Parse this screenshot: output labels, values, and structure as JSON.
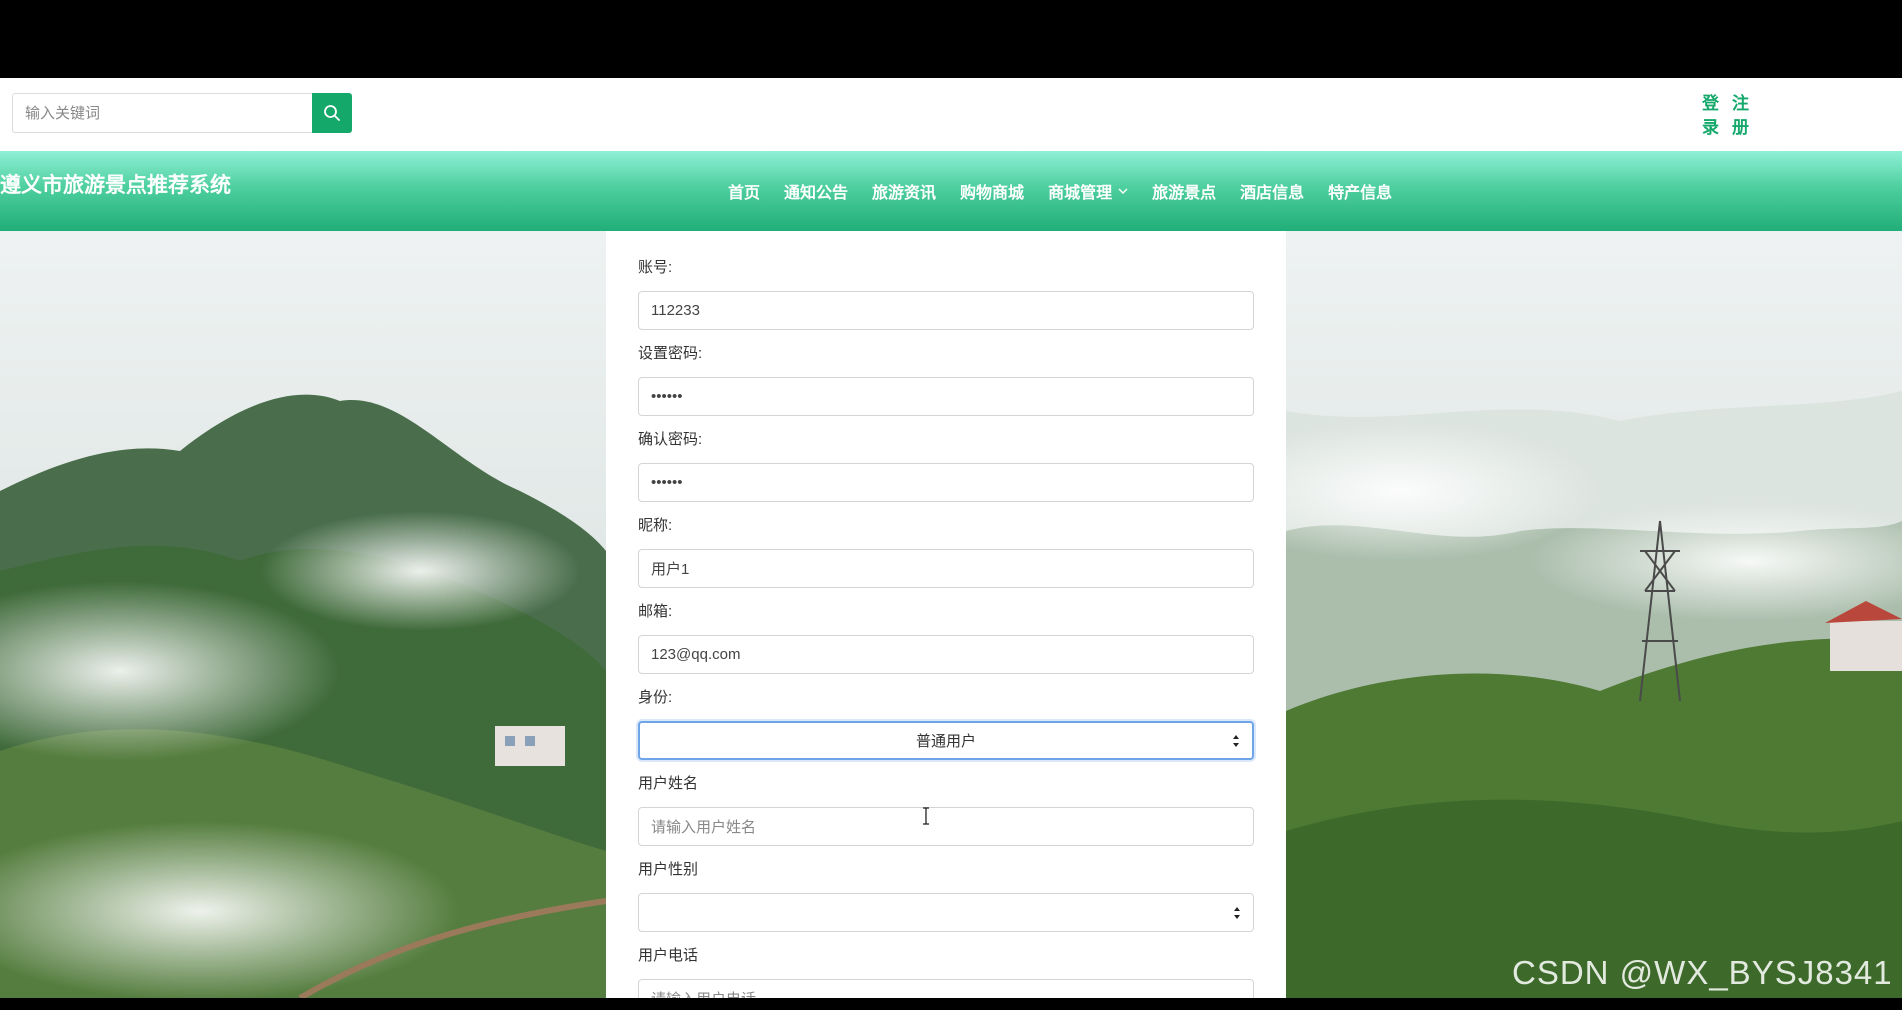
{
  "search": {
    "placeholder": "输入关键词"
  },
  "auth": {
    "login": "登录",
    "register": "注册"
  },
  "site_title": "遵义市旅游景点推荐系统",
  "nav": {
    "items": [
      "首页",
      "通知公告",
      "旅游资讯",
      "购物商城",
      "商城管理",
      "旅游景点",
      "酒店信息",
      "特产信息"
    ]
  },
  "form": {
    "account": {
      "label": "账号:",
      "value": "112233"
    },
    "password": {
      "label": "设置密码:",
      "value": "••••••"
    },
    "confirm": {
      "label": "确认密码:",
      "value": "••••••"
    },
    "nickname": {
      "label": "昵称:",
      "value": "用户1"
    },
    "email": {
      "label": "邮箱:",
      "value": "123@qq.com"
    },
    "role": {
      "label": "身份:",
      "value": "普通用户"
    },
    "real_name": {
      "label": "用户姓名",
      "placeholder": "请输入用户姓名"
    },
    "gender": {
      "label": "用户性别",
      "value": ""
    },
    "phone": {
      "label": "用户电话",
      "placeholder": "请输入用户电话"
    }
  },
  "watermark": "CSDN @WX_BYSJ8341",
  "colors": {
    "accent": "#14a86b",
    "nav_top": "#8ff0d6",
    "nav_bottom": "#22ae78"
  }
}
